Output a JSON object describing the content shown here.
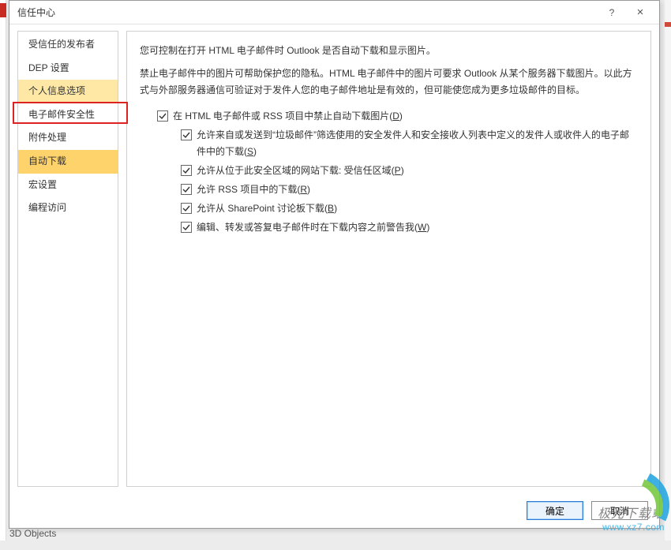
{
  "window": {
    "title": "信任中心",
    "help_label": "?",
    "close_label": "×"
  },
  "sidebar": {
    "items": [
      {
        "label": "受信任的发布者",
        "state": ""
      },
      {
        "label": "DEP 设置",
        "state": ""
      },
      {
        "label": "个人信息选项",
        "state": "highlight"
      },
      {
        "label": "电子邮件安全性",
        "state": "redbox"
      },
      {
        "label": "附件处理",
        "state": ""
      },
      {
        "label": "自动下载",
        "state": "selected"
      },
      {
        "label": "宏设置",
        "state": ""
      },
      {
        "label": "编程访问",
        "state": ""
      }
    ]
  },
  "content": {
    "intro": "您可控制在打开 HTML 电子邮件时 Outlook 是否自动下载和显示图片。",
    "desc": "禁止电子邮件中的图片可帮助保护您的隐私。HTML 电子邮件中的图片可要求 Outlook 从某个服务器下载图片。以此方式与外部服务器通信可验证对于发件人您的电子邮件地址是有效的，但可能使您成为更多垃圾邮件的目标。",
    "main_option": {
      "text": "在 HTML 电子邮件或 RSS 项目中禁止自动下载图片",
      "hotkey": "D",
      "checked": true
    },
    "sub_options": [
      {
        "text": "允许来自或发送到“垃圾邮件”筛选使用的安全发件人和安全接收人列表中定义的发件人或收件人的电子邮件中的下载",
        "hotkey": "S",
        "checked": true
      },
      {
        "text": "允许从位于此安全区域的网站下载: 受信任区域",
        "hotkey": "P",
        "checked": true
      },
      {
        "text": "允许 RSS 项目中的下载",
        "hotkey": "R",
        "checked": true
      },
      {
        "text": "允许从 SharePoint 讨论板下载",
        "hotkey": "B",
        "checked": true
      },
      {
        "text": "编辑、转发或答复电子邮件时在下载内容之前警告我",
        "hotkey": "W",
        "checked": true
      }
    ]
  },
  "footer": {
    "ok": "确定",
    "cancel": "取消"
  },
  "watermark": {
    "cn": "极光下载站",
    "url": "www.xz7.com"
  },
  "desktop_item": "3D Objects"
}
